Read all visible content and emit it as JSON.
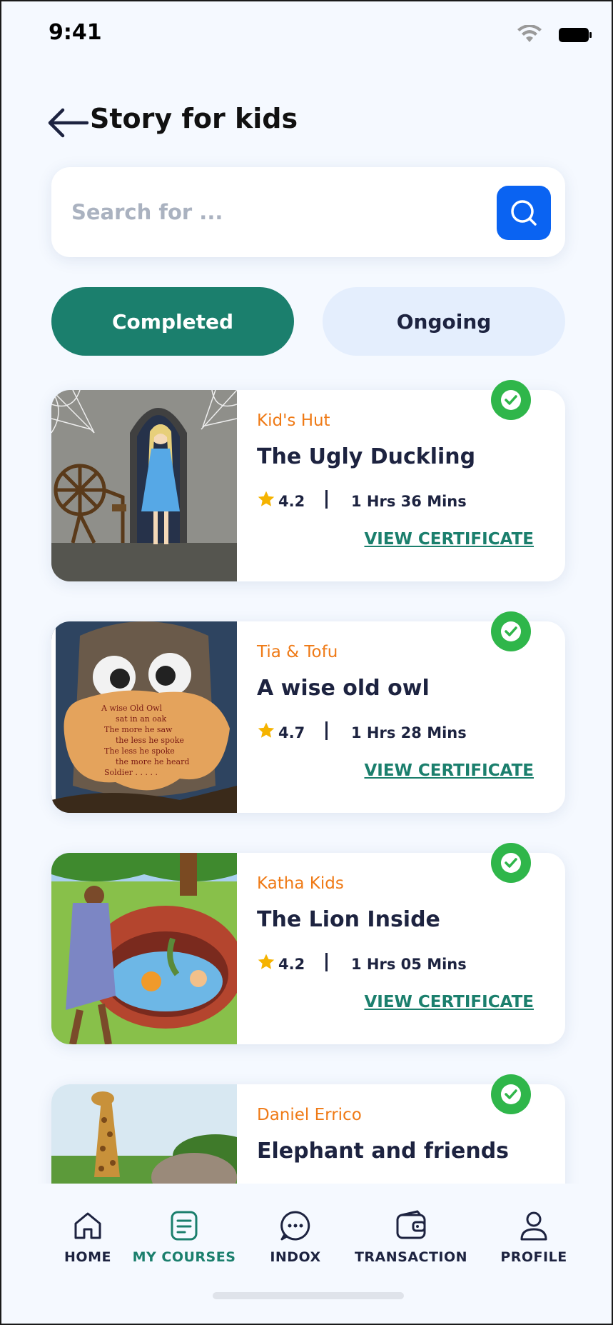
{
  "status_bar": {
    "time": "9:41"
  },
  "header": {
    "title": "Story for kids"
  },
  "search": {
    "placeholder": "Search for ..."
  },
  "tabs": [
    {
      "label": "Completed",
      "active": true
    },
    {
      "label": "Ongoing",
      "active": false
    }
  ],
  "courses": [
    {
      "author": "Kid's Hut",
      "title": "The Ugly Duckling",
      "rating": "4.2",
      "duration": "1 Hrs 36 Mins",
      "action": "VIEW CERTIFICATE",
      "completed": true
    },
    {
      "author": "Tia & Tofu",
      "title": "A wise old owl",
      "rating": "4.7",
      "duration": "1 Hrs 28 Mins",
      "action": "VIEW CERTIFICATE",
      "completed": true
    },
    {
      "author": "Katha Kids",
      "title": "The Lion Inside",
      "rating": "4.2",
      "duration": "1 Hrs 05 Mins",
      "action": "VIEW CERTIFICATE",
      "completed": true
    },
    {
      "author": "Daniel Errico",
      "title": "Elephant and friends",
      "completed": true
    }
  ],
  "bottom_nav": [
    {
      "label": "HOME",
      "icon": "home-icon",
      "active": false
    },
    {
      "label": "MY COURSES",
      "icon": "courses-icon",
      "active": true
    },
    {
      "label": "INDOX",
      "icon": "chat-icon",
      "active": false
    },
    {
      "label": "TRANSACTION",
      "icon": "wallet-icon",
      "active": false
    },
    {
      "label": "PROFILE",
      "icon": "profile-icon",
      "active": false
    }
  ],
  "colors": {
    "primary": "#1b7f6d",
    "accent_blue": "#0a63f2",
    "author_orange": "#ef7a16",
    "badge_green": "#2fb64a",
    "star_yellow": "#f5b300",
    "text_dark": "#1d2340"
  }
}
